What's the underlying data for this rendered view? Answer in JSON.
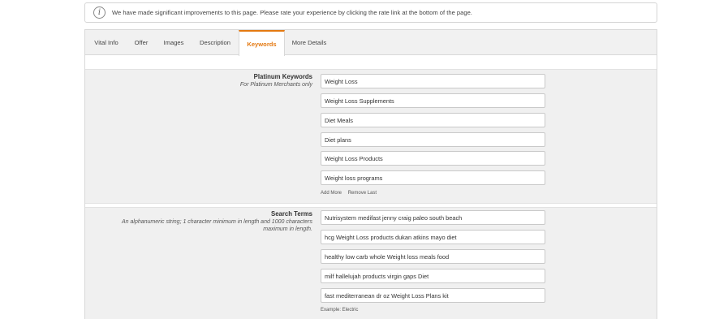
{
  "notice": {
    "icon": "info-icon",
    "message": "We have made significant improvements to this page. Please rate your experience by clicking the rate link at the bottom of the page."
  },
  "tabs": [
    {
      "label": "Vital Info"
    },
    {
      "label": "Offer"
    },
    {
      "label": "Images"
    },
    {
      "label": "Description"
    },
    {
      "label": "Keywords",
      "active": true
    },
    {
      "label": "More Details"
    }
  ],
  "platinum": {
    "title": "Platinum Keywords",
    "subtitle": "For Platinum Merchants only",
    "values": [
      "Weight Loss",
      "Weight Loss Supplements",
      "Diet Meals",
      "Diet plans",
      "Weight Loss Products",
      "Weight loss programs"
    ],
    "add_more": "Add More",
    "remove_last": "Remove Last"
  },
  "search_terms": {
    "title": "Search Terms",
    "subtitle_line1": "An alphanumeric string; 1 character minimum in length and 1000 characters",
    "subtitle_line2": "maximum in length.",
    "values": [
      "Nutrisystem medifast jenny craig paleo south beach",
      "hcg Weight Loss products dukan atkins mayo diet",
      "healthy low carb whole Weight loss meals food",
      "milf hallelujah products virgin gaps Diet",
      "fast mediterranean dr oz Weight Loss Plans kit"
    ],
    "example": "Example:  Electric"
  },
  "colors": {
    "accent": "#e47911",
    "section_bg": "#f0f0f0",
    "tab_bar_bg": "#f1f1f1"
  }
}
